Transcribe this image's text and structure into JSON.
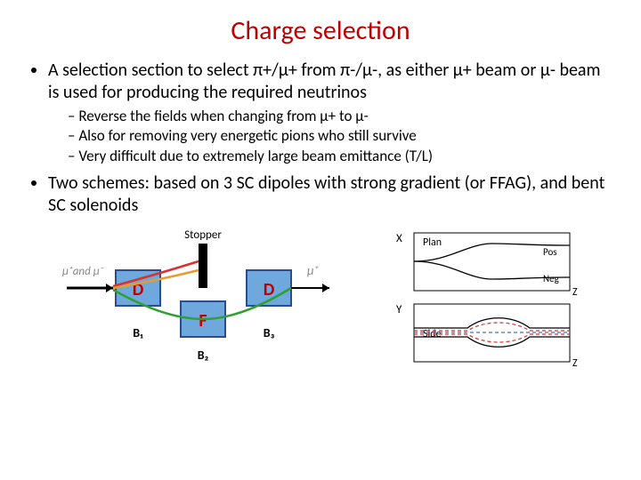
{
  "title": "Charge selection",
  "bullets": {
    "b1": "A selection section to select π+/μ+ from π-/μ-, as either μ+ beam or μ- beam is used for producing the required neutrinos",
    "sub": {
      "s1": "Reverse the fields when changing from μ+ to μ-",
      "s2": "Also for removing very energetic pions who still survive",
      "s3": "Very difficult due to extremely large beam emittance (T/L)"
    },
    "b2": "Two schemes: based on 3 SC dipoles with strong gradient (or FFAG), and bent SC solenoids"
  },
  "diagram_left": {
    "input_label": "μ⁺and μ⁻",
    "output_label": "μ⁺",
    "stopper": "Stopper",
    "D1": "D",
    "D2": "D",
    "F": "F",
    "B1": "B₁",
    "B2": "B₂",
    "B3": "B₃"
  },
  "diagram_right": {
    "X": "X",
    "Y": "Y",
    "Z1": "Z",
    "Z2": "Z",
    "Plan": "Plan",
    "Side": "Side",
    "Pos": "Pos",
    "Neg": "Neg"
  }
}
